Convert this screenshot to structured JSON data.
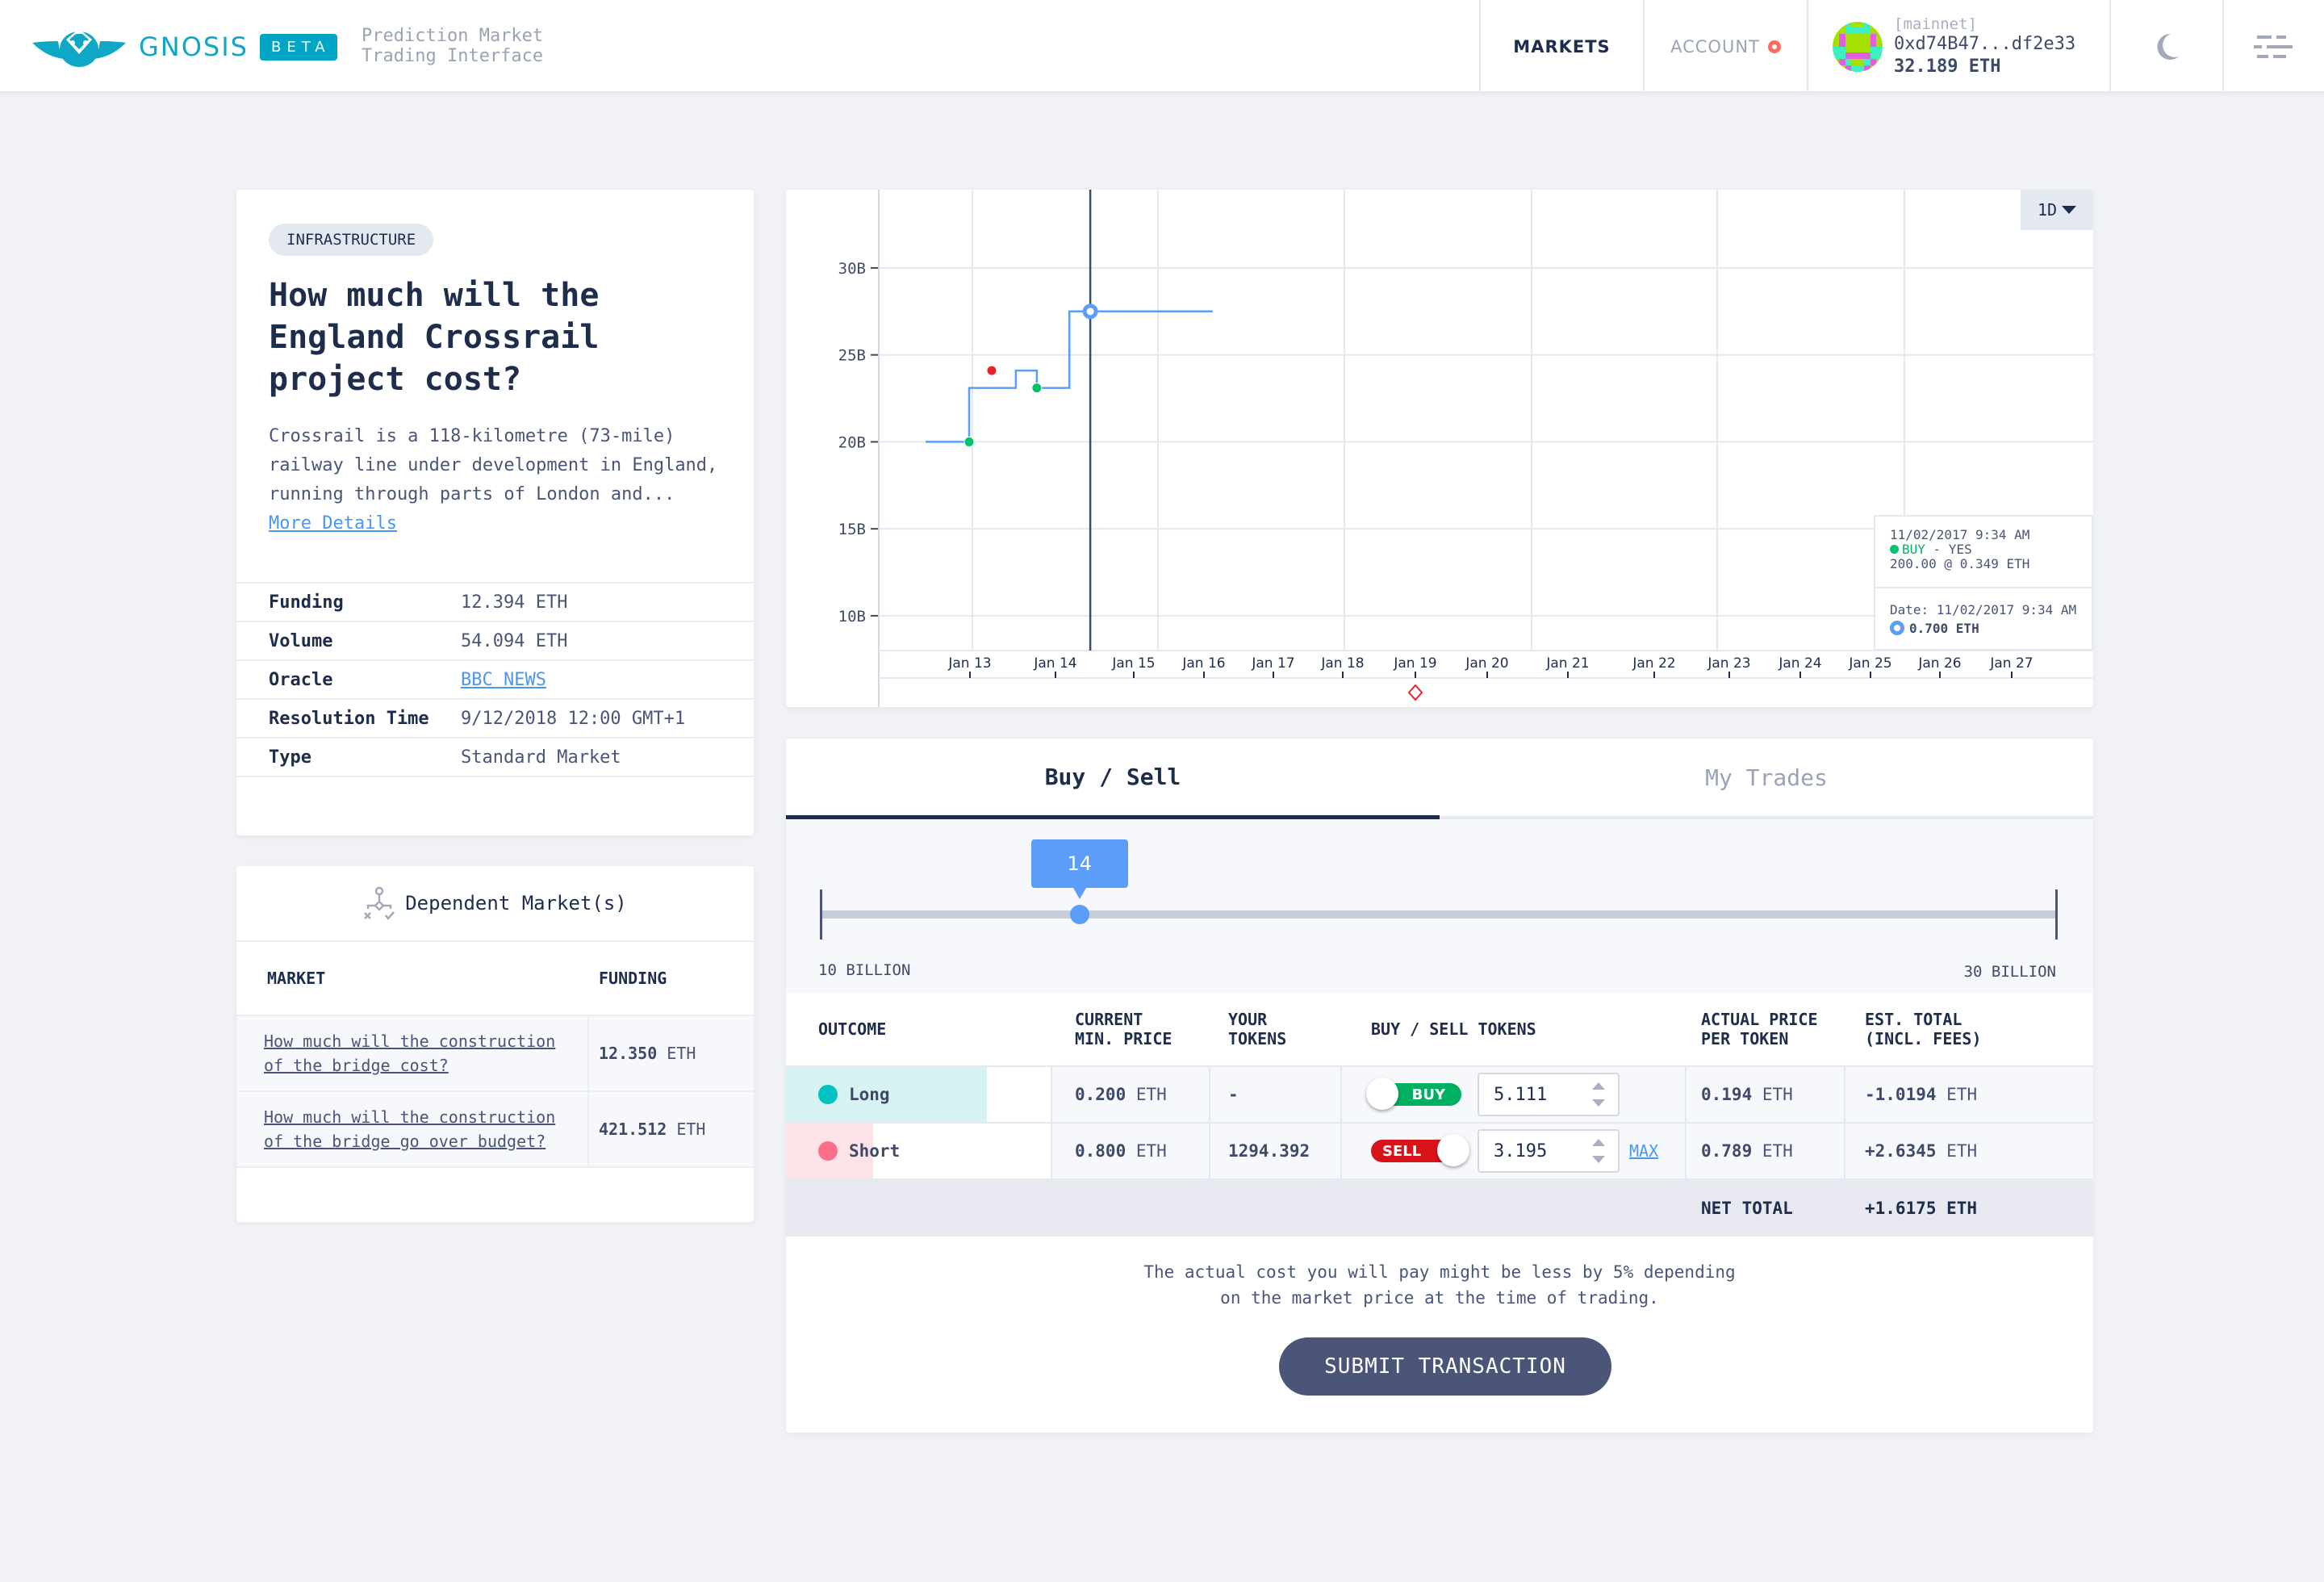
{
  "header": {
    "brand": "GNOSIS",
    "badge": "BETA",
    "tagline_1": "Prediction Market",
    "tagline_2": "Trading Interface",
    "nav_markets": "MARKETS",
    "nav_account": "ACCOUNT",
    "wallet": {
      "network": "[mainnet]",
      "address": "0xd74B47...df2e33",
      "balance": "32.189 ETH"
    },
    "icons": {
      "logo": "owl-logo-icon",
      "theme": "moon-icon",
      "menu": "menu-icon",
      "account_alert": "alert-dot-icon"
    }
  },
  "market": {
    "category": "INFRASTRUCTURE",
    "title": "How much will the England Crossrail project cost?",
    "description": "Crossrail is a 118-kilometre (73-mile) railway line under development in England, running through parts of London and...",
    "more_details": "More Details",
    "details": [
      {
        "label": "Funding",
        "value": "12.394 ETH"
      },
      {
        "label": "Volume",
        "value": "54.094 ETH"
      },
      {
        "label": "Oracle",
        "value": "BBC NEWS",
        "link": true
      },
      {
        "label": "Resolution Time",
        "value": "9/12/2018 12:00 GMT+1"
      },
      {
        "label": "Type",
        "value": "Standard Market"
      }
    ]
  },
  "dependent": {
    "title": "Dependent Market(s)",
    "col_market": "MARKET",
    "col_funding": "FUNDING",
    "rows": [
      {
        "market": "How much will the construction of the bridge cost?",
        "funding_num": "12.350",
        "funding_unit": "ETH"
      },
      {
        "market": "How much will the construction of the bridge go over budget?",
        "funding_num": "421.512",
        "funding_unit": "ETH"
      }
    ]
  },
  "chart_data": {
    "type": "line",
    "subtype": "step",
    "period": "1D",
    "yticks": [
      "30B",
      "25B",
      "20B",
      "15B",
      "10B"
    ],
    "ytick_values": [
      30,
      25,
      20,
      15,
      10
    ],
    "ylim": [
      8,
      34.5
    ],
    "xticks": [
      "Jan 13",
      "Jan 14",
      "Jan 15",
      "Jan 16",
      "Jan 17",
      "Jan 18",
      "Jan 19",
      "Jan 20",
      "Jan 21",
      "Jan 22",
      "Jan 23",
      "Jan 24",
      "Jan 25",
      "Jan 26",
      "Jan 27"
    ],
    "xtick_positions_days": [
      13,
      14.1,
      15,
      15.8,
      16.6,
      17.4,
      18.25,
      19.05,
      19.98,
      20.96,
      21.82,
      22.63,
      23.44,
      24.23,
      25.05
    ],
    "xlim_days": [
      12.43,
      26.0
    ],
    "series": [
      {
        "name": "price",
        "color": "#5b9df9",
        "points": [
          {
            "day": 12.43,
            "value": 20.0
          },
          {
            "day": 12.99,
            "value": 20.0
          },
          {
            "day": 12.99,
            "value": 23.1
          },
          {
            "day": 13.59,
            "value": 23.1
          },
          {
            "day": 13.59,
            "value": 24.1
          },
          {
            "day": 13.86,
            "value": 24.1
          },
          {
            "day": 13.86,
            "value": 23.1
          },
          {
            "day": 14.26,
            "value": 23.1
          },
          {
            "day": 14.26,
            "value": 27.5
          },
          {
            "day": 15.9,
            "value": 27.5
          }
        ]
      }
    ],
    "trades": [
      {
        "day": 12.99,
        "value": 20.0,
        "side": "buy",
        "color": "#00c16e"
      },
      {
        "day": 13.28,
        "value": 24.1,
        "side": "sell",
        "color": "#e8242b"
      },
      {
        "day": 13.86,
        "value": 23.1,
        "side": "buy",
        "color": "#00c16e"
      }
    ],
    "hover": {
      "day": 14.5,
      "value": 27.5
    },
    "marker": {
      "day": 18.25,
      "shape": "diamond",
      "color": "#e8242b"
    },
    "tooltip_trade": {
      "date": "11/02/2017 9:34 AM",
      "side": "BUY",
      "outcome": " - YES",
      "detail": "200.00 @ 0.349 ETH"
    },
    "tooltip_price": {
      "date": "Date: 11/02/2017 9:34 AM",
      "value": "0.700 ETH"
    }
  },
  "trade": {
    "tabs": [
      {
        "label": "Buy / Sell",
        "active": true
      },
      {
        "label": "My Trades",
        "active": false
      }
    ],
    "slider": {
      "value": "14",
      "min_label": "10 BILLION",
      "max_label": "30 BILLION",
      "min": 10,
      "max": 30,
      "current": 14.2
    },
    "columns": [
      "OUTCOME",
      "CURRENT\nMIN. PRICE",
      "YOUR\nTOKENS",
      "BUY / SELL TOKENS",
      "ACTUAL PRICE\nPER TOKEN",
      "EST. TOTAL\n(INCL. FEES)"
    ],
    "col_outcome": "OUTCOME",
    "col_price_1": "CURRENT",
    "col_price_2": "MIN. PRICE",
    "col_tokens_1": "YOUR",
    "col_tokens_2": "TOKENS",
    "col_buysell": "BUY / SELL TOKENS",
    "col_actual_1": "ACTUAL PRICE",
    "col_actual_2": "PER TOKEN",
    "col_total_1": "EST. TOTAL",
    "col_total_2": "(INCL. FEES)",
    "rows": [
      {
        "outcome": "Long",
        "color": "#00c2c2",
        "bg": "#d7f2f3",
        "fill": 0.76,
        "price_num": "0.200",
        "price_unit": "ETH",
        "tokens": "-",
        "mode": "BUY",
        "mode_color": "#00b060",
        "amount": "5.111",
        "show_max": false,
        "actual_num": "0.194",
        "actual_unit": "ETH",
        "total_num": "-1.0194",
        "total_unit": "ETH"
      },
      {
        "outcome": "Short",
        "color": "#fb6f8a",
        "bg": "#fde3e8",
        "fill": 0.33,
        "price_num": "0.800",
        "price_unit": "ETH",
        "tokens": "1294.392",
        "mode": "SELL",
        "mode_color": "#d9121a",
        "amount": "3.195",
        "show_max": true,
        "actual_num": "0.789",
        "actual_unit": "ETH",
        "total_num": "+2.6345",
        "total_unit": "ETH"
      }
    ],
    "max_label": "MAX",
    "net_label": "NET TOTAL",
    "net_value": "+1.6175 ETH",
    "note_1": "The actual cost you will pay might be less by 5% depending",
    "note_2": "on the market price at the time of trading.",
    "submit": "SUBMIT TRANSACTION"
  }
}
